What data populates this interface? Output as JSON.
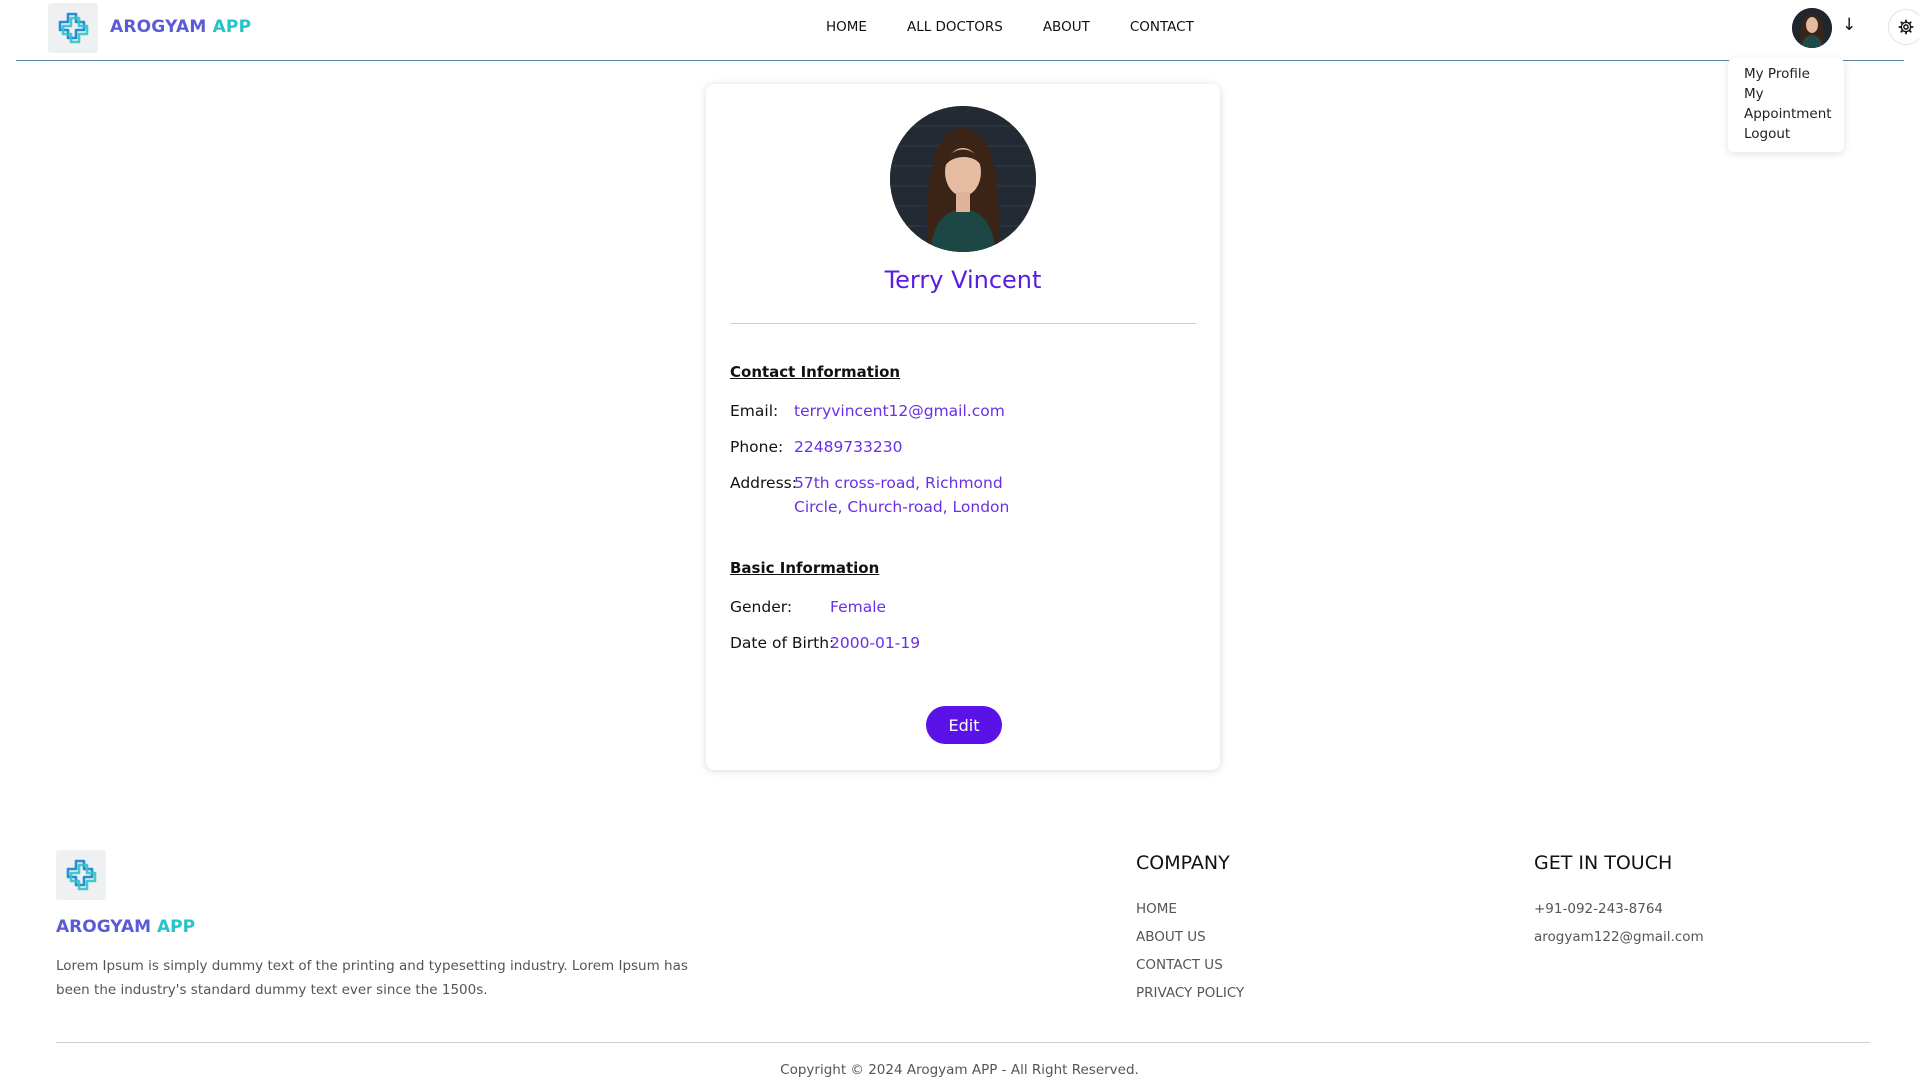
{
  "header": {
    "brand_part1": "AROGYAM",
    "brand_part2": "APP",
    "nav": [
      "HOME",
      "ALL DOCTORS",
      "ABOUT",
      "CONTACT"
    ]
  },
  "dropdown": {
    "items": [
      "My Profile",
      "My",
      "Appointment",
      "Logout"
    ]
  },
  "profile": {
    "name": "Terry Vincent",
    "contact_title": "Contact Information",
    "email_label": "Email:",
    "email": "terryvincent12@gmail.com",
    "phone_label": "Phone:",
    "phone": "22489733230",
    "address_label": "Address:",
    "address_line1": "57th cross-road, Richmond",
    "address_line2": "Circle, Church-road, London",
    "basic_title": "Basic Information",
    "gender_label": "Gender:",
    "gender": "Female",
    "dob_label": "Date of Birth:",
    "dob": "2000-01-19",
    "edit_label": "Edit"
  },
  "footer": {
    "brand_part1": "AROGYAM",
    "brand_part2": "APP",
    "description": "Lorem Ipsum is simply dummy text of the printing and typesetting industry. Lorem Ipsum has been the industry's standard dummy text ever since the 1500s.",
    "company_heading": "COMPANY",
    "company_links": [
      "HOME",
      "ABOUT US",
      "CONTACT US",
      "PRIVACY POLICY"
    ],
    "contact_heading": "GET IN TOUCH",
    "phone": "+91-092-243-8764",
    "email": "arogyam122@gmail.com",
    "copyright": "Copyright © 2024 Arogyam APP - All Right Reserved."
  },
  "colors": {
    "brand_purple": "#5b5bd6",
    "brand_teal": "#25c4c9",
    "accent": "#5b12e8",
    "value_text": "#6a2fe6"
  },
  "icons": [
    "medical-cross-logo-icon",
    "arrow-down-icon",
    "gear-icon"
  ]
}
